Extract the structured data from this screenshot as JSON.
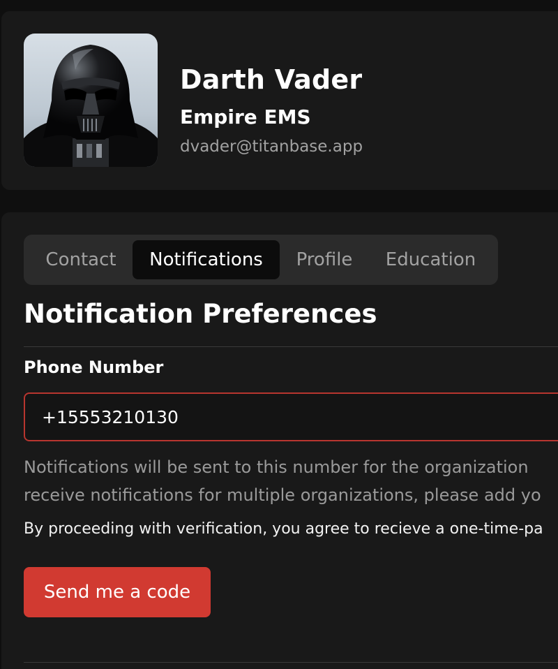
{
  "profile": {
    "name": "Darth Vader",
    "organization": "Empire EMS",
    "email": "dvader@titanbase.app"
  },
  "tabs": [
    {
      "label": "Contact",
      "active": false
    },
    {
      "label": "Notifications",
      "active": true
    },
    {
      "label": "Profile",
      "active": false
    },
    {
      "label": "Education",
      "active": false
    }
  ],
  "notifications": {
    "title": "Notification Preferences",
    "phone_label": "Phone Number",
    "phone_value": "+15553210130",
    "help_line_1": "Notifications will be sent to this number for the organization",
    "help_line_2": "receive notifications for multiple organizations, please add yo",
    "consent": "By proceeding with verification, you agree to recieve a one-time-pa",
    "send_button": "Send me a code"
  },
  "colors": {
    "background": "#0f0f0f",
    "card": "#191919",
    "accent": "#d13a31",
    "input_border": "#b8352f"
  }
}
